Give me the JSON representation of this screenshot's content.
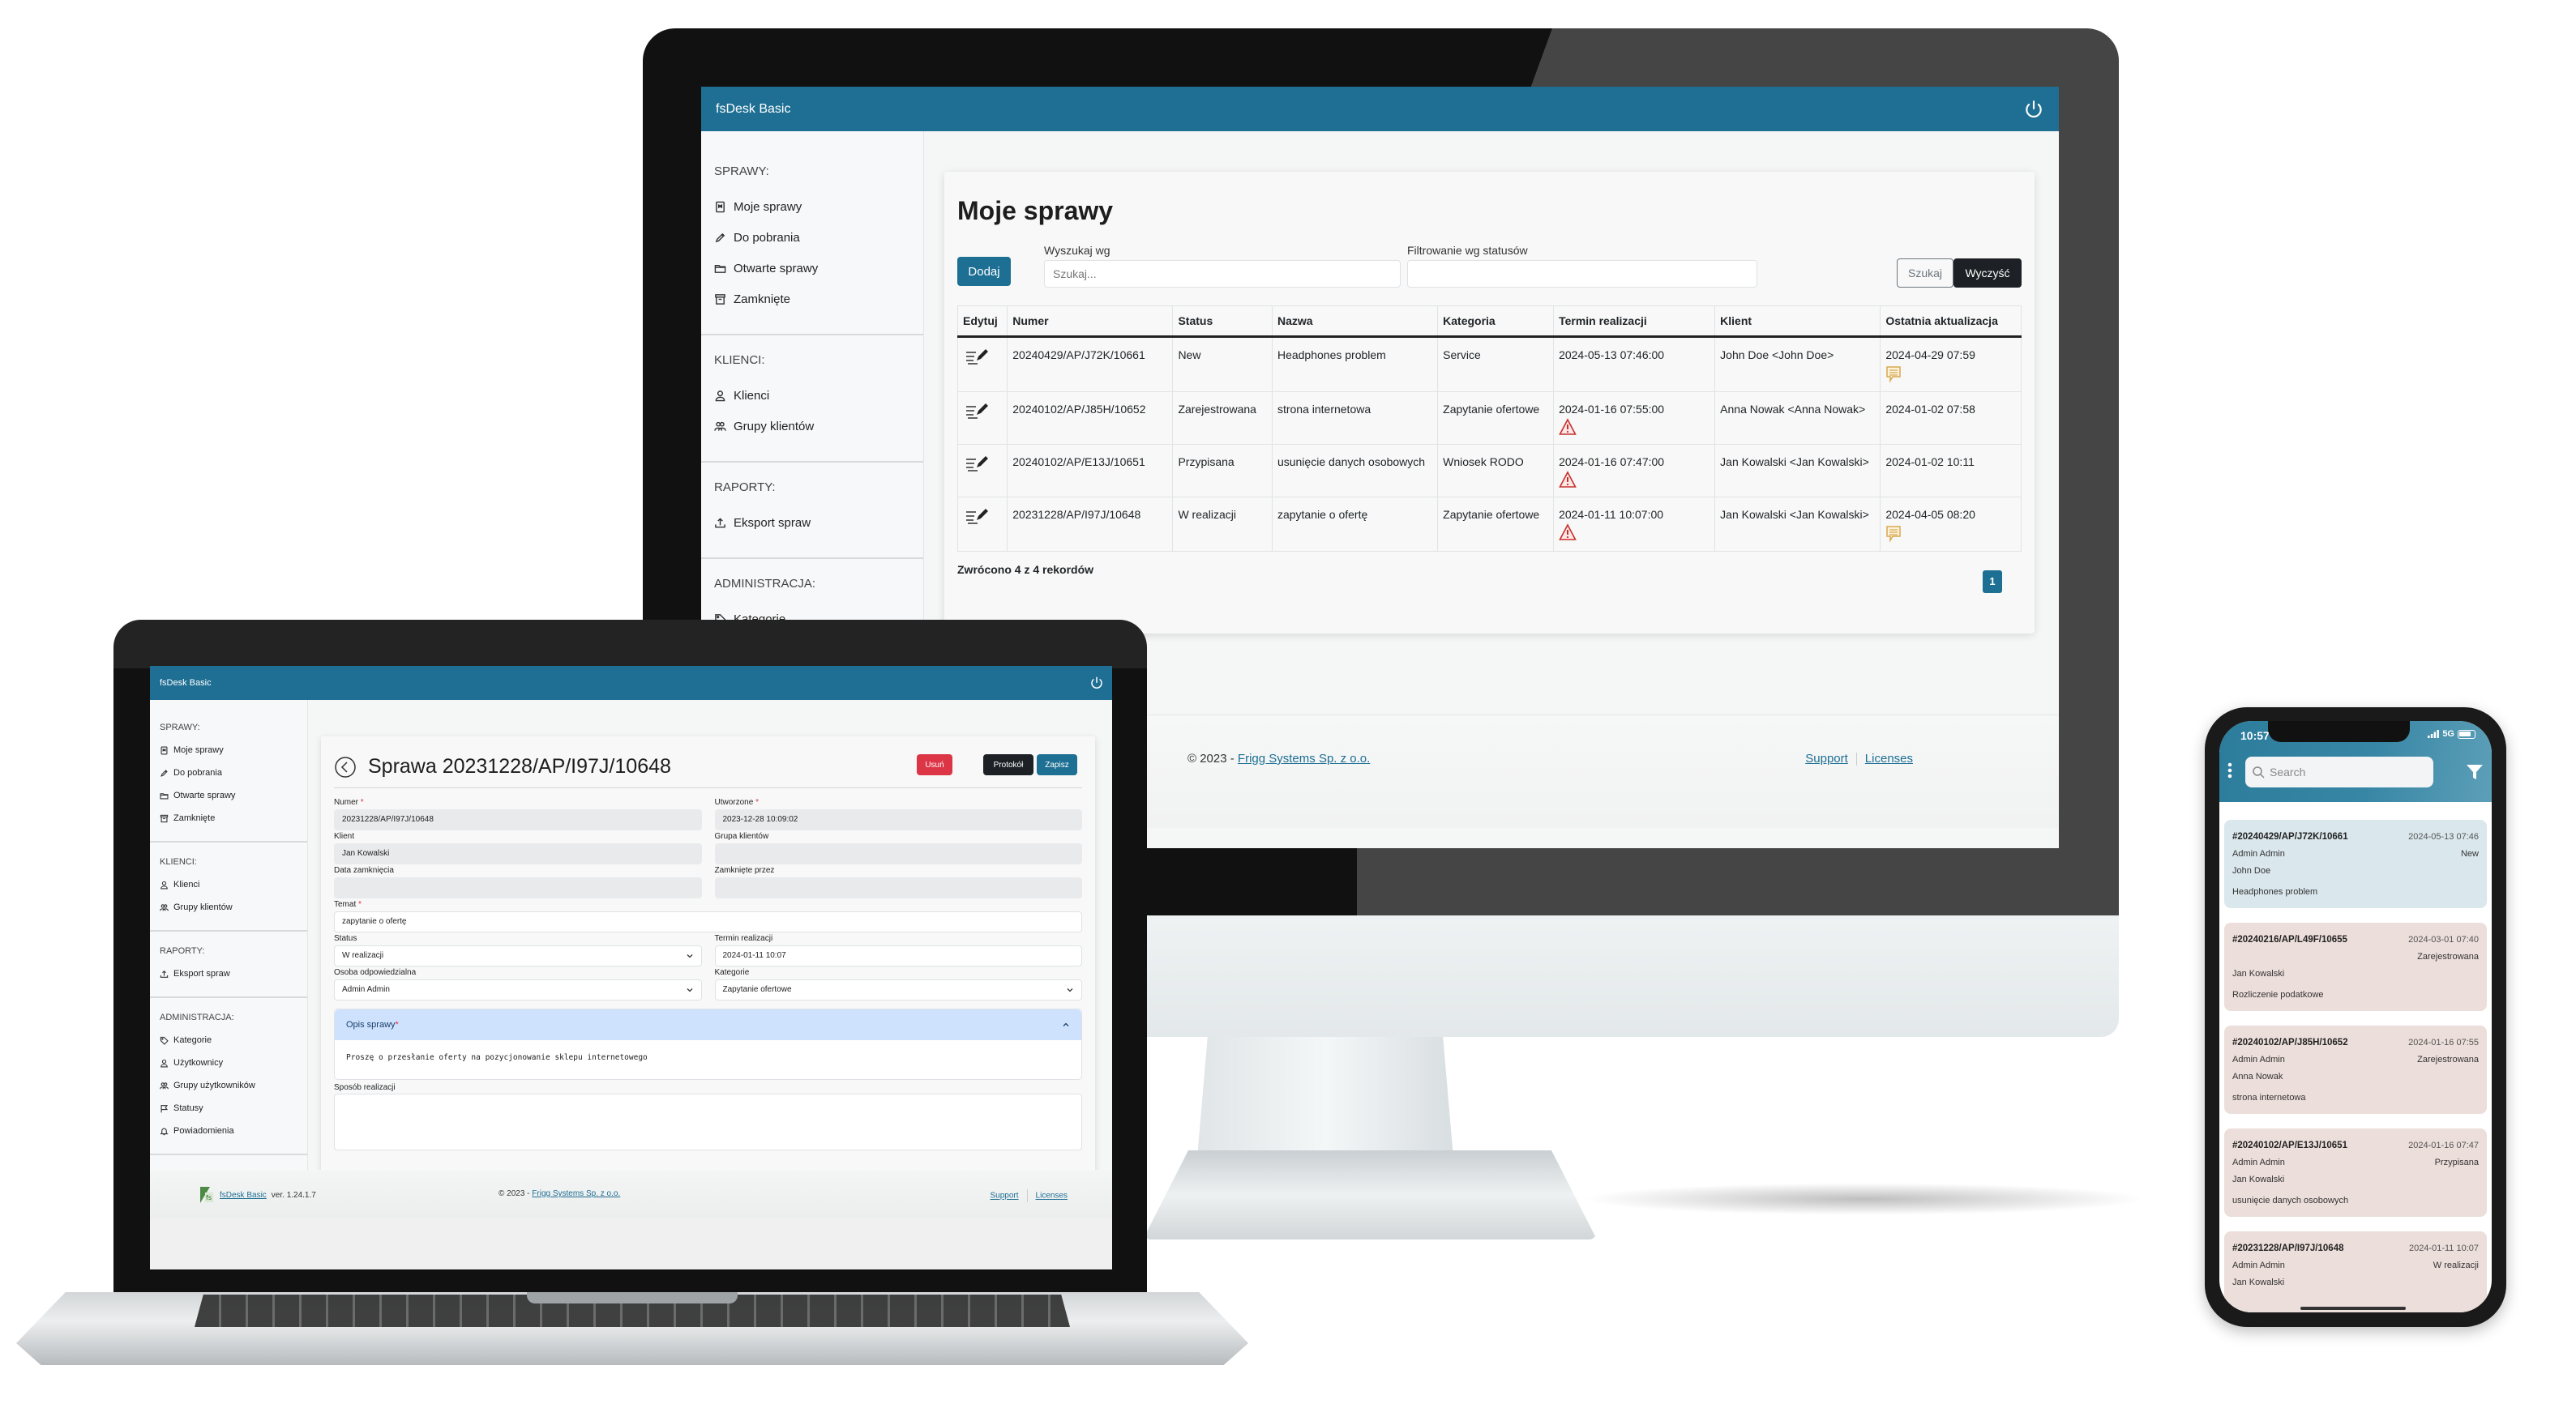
{
  "desktop": {
    "app_title": "fsDesk Basic",
    "sidebar": [
      {
        "title": "SPRAWY:",
        "items": [
          {
            "icon": "bookmark-icon",
            "label": "Moje sprawy"
          },
          {
            "icon": "pencil-icon",
            "label": "Do pobrania"
          },
          {
            "icon": "folder-icon",
            "label": "Otwarte sprawy"
          },
          {
            "icon": "archive-icon",
            "label": "Zamknięte"
          }
        ]
      },
      {
        "title": "KLIENCI:",
        "items": [
          {
            "icon": "person-icon",
            "label": "Klienci"
          },
          {
            "icon": "people-icon",
            "label": "Grupy klientów"
          }
        ]
      },
      {
        "title": "RAPORTY:",
        "items": [
          {
            "icon": "upload-icon",
            "label": "Eksport spraw"
          }
        ]
      },
      {
        "title": "ADMINISTRACJA:",
        "items": [
          {
            "icon": "tag-icon",
            "label": "Kategorie"
          }
        ]
      }
    ],
    "page_title": "Moje sprawy",
    "add_button": "Dodaj",
    "search_label": "Wyszukaj wg",
    "search_placeholder": "Szukaj...",
    "filter_label": "Filtrowanie wg statusów",
    "filter_value": "",
    "search_button": "Szukaj",
    "clear_button": "Wyczyść",
    "table": {
      "columns": [
        "Edytuj",
        "Numer",
        "Status",
        "Nazwa",
        "Kategoria",
        "Termin realizacji",
        "Klient",
        "Ostatnia aktualizacja"
      ],
      "rows": [
        {
          "numer": "20240429/AP/J72K/10661",
          "status": "New",
          "nazwa": "Headphones problem",
          "kategoria": "Service",
          "termin": "2024-05-13 07:46:00",
          "overdue": false,
          "klient": "John Doe <John Doe>",
          "aktualizacja": "2024-04-29 07:59",
          "has_comment": true
        },
        {
          "numer": "20240102/AP/J85H/10652",
          "status": "Zarejestrowana",
          "nazwa": "strona internetowa",
          "kategoria": "Zapytanie ofertowe",
          "termin": "2024-01-16 07:55:00",
          "overdue": true,
          "klient": "Anna Nowak <Anna Nowak>",
          "aktualizacja": "2024-01-02 07:58",
          "has_comment": false
        },
        {
          "numer": "20240102/AP/E13J/10651",
          "status": "Przypisana",
          "nazwa": "usunięcie danych osobowych",
          "kategoria": "Wniosek RODO",
          "termin": "2024-01-16 07:47:00",
          "overdue": true,
          "klient": "Jan Kowalski <Jan Kowalski>",
          "aktualizacja": "2024-01-02 10:11",
          "has_comment": false
        },
        {
          "numer": "20231228/AP/I97J/10648",
          "status": "W realizacji",
          "nazwa": "zapytanie o ofertę",
          "kategoria": "Zapytanie ofertowe",
          "termin": "2024-01-11 10:07:00",
          "overdue": true,
          "klient": "Jan Kowalski <Jan Kowalski>",
          "aktualizacja": "2024-04-05 08:20",
          "has_comment": true
        }
      ]
    },
    "record_count": "Zwrócono 4 z 4 rekordów",
    "current_page": "1",
    "footer": {
      "copyright": "© 2023 - ",
      "company_link": "Frigg Systems Sp. z o.o.",
      "support_link": "Support",
      "licenses_link": "Licenses"
    }
  },
  "laptop": {
    "app_title": "fsDesk Basic",
    "sidebar": [
      {
        "title": "SPRAWY:",
        "items": [
          {
            "icon": "bookmark-icon",
            "label": "Moje sprawy"
          },
          {
            "icon": "pencil-icon",
            "label": "Do pobrania"
          },
          {
            "icon": "folder-icon",
            "label": "Otwarte sprawy"
          },
          {
            "icon": "archive-icon",
            "label": "Zamknięte"
          }
        ]
      },
      {
        "title": "KLIENCI:",
        "items": [
          {
            "icon": "person-icon",
            "label": "Klienci"
          },
          {
            "icon": "people-icon",
            "label": "Grupy klientów"
          }
        ]
      },
      {
        "title": "RAPORTY:",
        "items": [
          {
            "icon": "upload-icon",
            "label": "Eksport spraw"
          }
        ]
      },
      {
        "title": "ADMINISTRACJA:",
        "items": [
          {
            "icon": "tag-icon",
            "label": "Kategorie"
          },
          {
            "icon": "person-icon",
            "label": "Użytkownicy"
          },
          {
            "icon": "people-icon",
            "label": "Grupy użytkowników"
          },
          {
            "icon": "flag-icon",
            "label": "Statusy"
          },
          {
            "icon": "bell-icon",
            "label": "Powiadomienia"
          }
        ]
      }
    ],
    "page_title": "Sprawa 20231228/AP/I97J/10648",
    "delete_button": "Usuń",
    "protocol_button": "Protokół",
    "save_button": "Zapisz",
    "form": {
      "numer_label": "Numer",
      "numer_value": "20231228/AP/I97J/10648",
      "utworzone_label": "Utworzone",
      "utworzone_value": "2023-12-28 10:09:02",
      "klient_label": "Klient",
      "klient_value": "Jan Kowalski",
      "grupa_label": "Grupa klientów",
      "grupa_value": "",
      "data_zamkniecia_label": "Data zamknięcia",
      "data_zamkniecia_value": "",
      "zamkniete_przez_label": "Zamknięte przez",
      "zamkniete_przez_value": "",
      "temat_label": "Temat",
      "temat_value": "zapytanie o ofertę",
      "status_label": "Status",
      "status_value": "W realizacji",
      "termin_label": "Termin realizacji",
      "termin_value": "2024-01-11 10:07",
      "osoba_label": "Osoba odpowiedzialna",
      "osoba_value": "Admin Admin",
      "kategorie_label": "Kategorie",
      "kategorie_value": "Zapytanie ofertowe",
      "required_mark": "*"
    },
    "opis_label": "Opis sprawy",
    "opis_value": "Proszę o przesłanie oferty na pozycjonowanie sklepu internetowego",
    "sposob_label": "Sposób realizacji",
    "sposob_value": "",
    "footer": {
      "product_link": "fsDesk Basic",
      "version": " ver. 1.24.1.7",
      "copyright": "© 2023 - ",
      "company_link": "Frigg Systems Sp. z o.o.",
      "support_link": "Support",
      "licenses_link": "Licenses"
    }
  },
  "phone": {
    "time": "10:57",
    "network": "5G",
    "search_placeholder": "Search",
    "cases": [
      {
        "numer": "#20240429/AP/J72K/10661",
        "date": "2024-05-13 07:46",
        "assignee": "Admin Admin",
        "status": "New",
        "client": "John Doe",
        "subject": "Headphones problem",
        "tone": "blue"
      },
      {
        "numer": "#20240216/AP/L49F/10655",
        "date": "2024-03-01 07:40",
        "assignee": "",
        "status": "Zarejestrowana",
        "client": "Jan Kowalski",
        "subject": "Rozliczenie podatkowe",
        "tone": "pink"
      },
      {
        "numer": "#20240102/AP/J85H/10652",
        "date": "2024-01-16 07:55",
        "assignee": "Admin Admin",
        "status": "Zarejestrowana",
        "client": "Anna Nowak",
        "subject": "strona internetowa",
        "tone": "pink"
      },
      {
        "numer": "#20240102/AP/E13J/10651",
        "date": "2024-01-16 07:47",
        "assignee": "Admin Admin",
        "status": "Przypisana",
        "client": "Jan Kowalski",
        "subject": "usunięcie danych osobowych",
        "tone": "pink"
      },
      {
        "numer": "#20231228/AP/I97J/10648",
        "date": "2024-01-11 10:07",
        "assignee": "Admin Admin",
        "status": "W realizacji",
        "client": "Jan Kowalski",
        "subject": "",
        "tone": "pink"
      }
    ]
  },
  "colors": {
    "brand": "#1e6f93",
    "danger": "#dc3545",
    "dark": "#1d2125",
    "warning_icon": "#c9302c",
    "comment_icon": "#d9a84e"
  }
}
